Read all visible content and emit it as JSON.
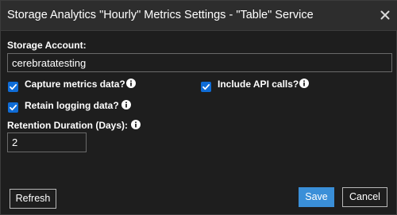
{
  "dialog": {
    "title": "Storage Analytics \"Hourly\" Metrics Settings - \"Table\" Service"
  },
  "storage_account": {
    "label": "Storage Account:",
    "value": "cerebratatesting"
  },
  "options": {
    "capture_metrics": {
      "label": "Capture metrics data?",
      "checked": true
    },
    "include_api_calls": {
      "label": "Include API calls?",
      "checked": true
    },
    "retain_logging": {
      "label": "Retain logging data?",
      "checked": true
    }
  },
  "retention": {
    "label": "Retention Duration (Days):",
    "value": "2"
  },
  "buttons": {
    "refresh": "Refresh",
    "save": "Save",
    "cancel": "Cancel"
  },
  "icons": {
    "close": "close-icon",
    "info": "info-icon",
    "checkbox": "checkmark-icon"
  },
  "colors": {
    "background": "#1e1e1e",
    "titlebar": "#2d2d2d",
    "checkbox": "#0f6cd6",
    "save_button": "#3a8fd8"
  }
}
